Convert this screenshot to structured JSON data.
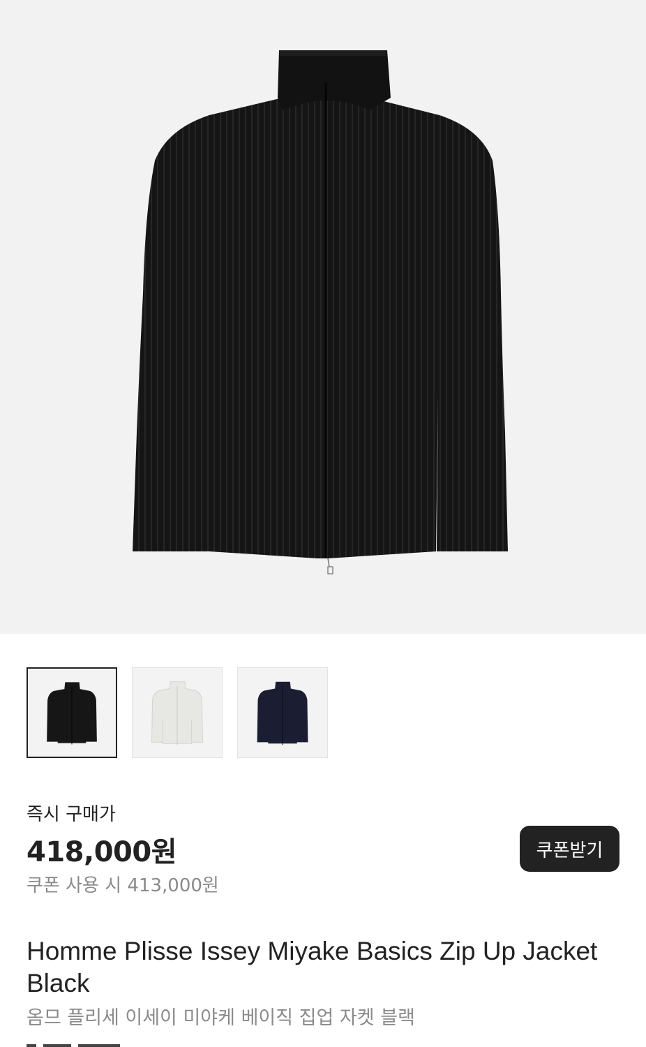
{
  "product": {
    "image_alt": "black zip-up jacket",
    "thumbnails": [
      {
        "name": "black",
        "color": "#161616",
        "selected": true
      },
      {
        "name": "light-grey",
        "color": "#e6e6e4",
        "selected": false
      },
      {
        "name": "navy",
        "color": "#1b1e33",
        "selected": false
      }
    ],
    "price_label": "즉시 구매가",
    "price": "418,000원",
    "coupon_price": "쿠폰 사용 시 413,000원",
    "coupon_button": "쿠폰받기",
    "title_en": "Homme Plisse Issey Miyake Basics Zip Up Jacket Black",
    "title_ko": "옴므 플리세 이세이 미야케 베이직 집업 자켓 블랙"
  },
  "colors": {
    "hero_bg": "#f2f2f2",
    "thumb_bg": "#f3f3f3",
    "text_primary": "#222222",
    "text_secondary": "#8a8a8a",
    "button_bg": "#222222"
  }
}
